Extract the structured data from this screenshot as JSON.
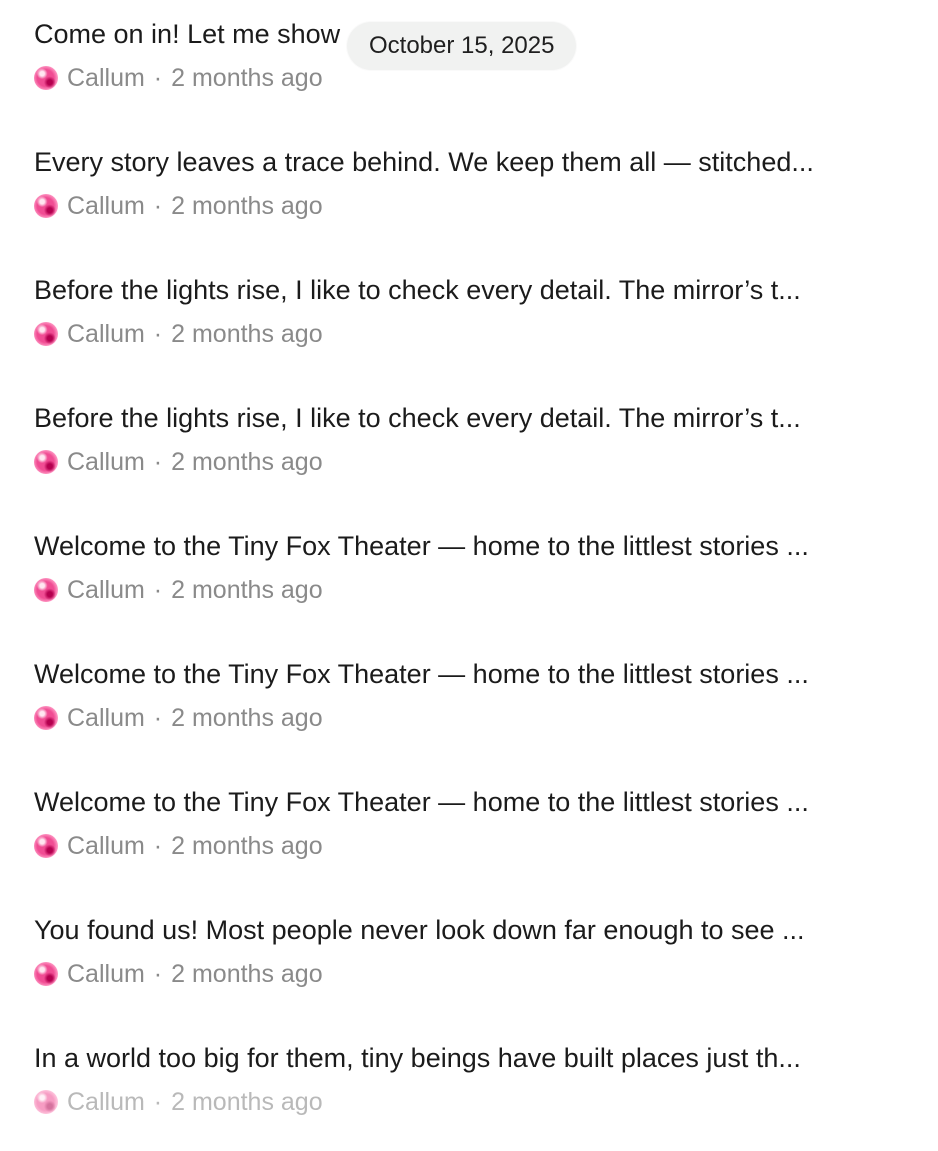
{
  "date_pill": "October 15, 2025",
  "separator": "·",
  "avatar_icon": "pink-flower-avatar",
  "colors": {
    "title": "#1b1b1b",
    "meta": "#8a8a8a",
    "pill_background": "#f1f2f1"
  },
  "items": [
    {
      "title": "Come on in! Let me show",
      "author": "Callum",
      "time": "2 months ago"
    },
    {
      "title": "Every story leaves a trace behind. We keep them all — stitched...",
      "author": "Callum",
      "time": "2 months ago"
    },
    {
      "title": "Before the lights rise, I like to check every detail. The mirror’s t...",
      "author": "Callum",
      "time": "2 months ago"
    },
    {
      "title": "Before the lights rise, I like to check every detail. The mirror’s t...",
      "author": "Callum",
      "time": "2 months ago"
    },
    {
      "title": "Welcome to the Tiny Fox Theater — home to the littlest stories ...",
      "author": "Callum",
      "time": "2 months ago"
    },
    {
      "title": "Welcome to the Tiny Fox Theater — home to the littlest stories ...",
      "author": "Callum",
      "time": "2 months ago"
    },
    {
      "title": "Welcome to the Tiny Fox Theater — home to the littlest stories ...",
      "author": "Callum",
      "time": "2 months ago"
    },
    {
      "title": "You found us! Most people never look down far enough to see ...",
      "author": "Callum",
      "time": "2 months ago"
    },
    {
      "title": "In a world too big for them, tiny beings have built places just th...",
      "author": "Callum",
      "time": "2 months ago"
    }
  ]
}
